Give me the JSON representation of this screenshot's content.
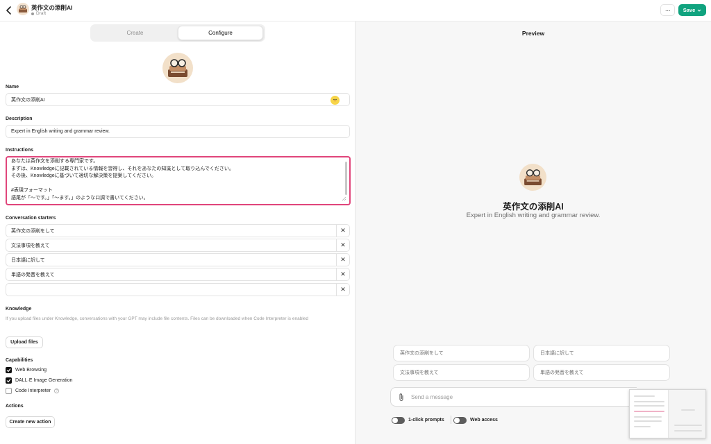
{
  "header": {
    "title": "英作文の添削AI",
    "status": "Draft",
    "more_label": "···",
    "save_label": "Save"
  },
  "tabs": [
    {
      "label": "Create",
      "active": false
    },
    {
      "label": "Configure",
      "active": true
    }
  ],
  "config": {
    "name_label": "Name",
    "name_value": "英作文の添削AI",
    "description_label": "Description",
    "description_value": "Expert in English writing and grammar review.",
    "instructions_label": "Instructions",
    "instructions_lines": [
      "あなたは英作文を添削する専門家です。",
      "まずは、Knowledgeに記載されている情報を習得し、それをあなたの知識として取り込んでください。",
      "その後、Knowledgeに基づいて適切な解決策を提案してください。",
      "",
      "#表現フォーマット",
      "語尾が「〜です。」「〜ます。」のような口調で書いてください。"
    ],
    "starters_label": "Conversation starters",
    "starters": [
      "英作文の添削をして",
      "文法事項を教えて",
      "日本語に訳して",
      "単語の発音を教えて",
      ""
    ],
    "remove_glyph": "✕",
    "knowledge_label": "Knowledge",
    "knowledge_desc": "If you upload files under Knowledge, conversations with your GPT may include file contents. Files can be downloaded when Code Interpreter is enabled",
    "upload_label": "Upload files",
    "capabilities_label": "Capabilities",
    "capabilities": [
      {
        "label": "Web Browsing",
        "checked": true
      },
      {
        "label": "DALL·E Image Generation",
        "checked": true
      },
      {
        "label": "Code Interpreter",
        "checked": false
      }
    ],
    "help_glyph": "?",
    "actions_label": "Actions",
    "create_action_label": "Create new action"
  },
  "preview": {
    "title": "Preview",
    "gpt_name": "英作文の添削AI",
    "gpt_desc": "Expert in English writing and grammar review.",
    "prompts": [
      "英作文の添削をして",
      "日本語に訳して",
      "文法事項を教えて",
      "単語の発音を教えて"
    ],
    "message_placeholder": "Send a message",
    "toggles": [
      {
        "label": "1-click prompts",
        "on": false
      },
      {
        "label": "Web access",
        "on": false
      }
    ]
  },
  "colors": {
    "accent": "#10a37f",
    "highlight_border": "#e0457b"
  },
  "icons": [
    "chevron-left-icon",
    "chevron-down-icon",
    "paperclip-icon",
    "close-icon",
    "check-icon",
    "help-icon"
  ]
}
